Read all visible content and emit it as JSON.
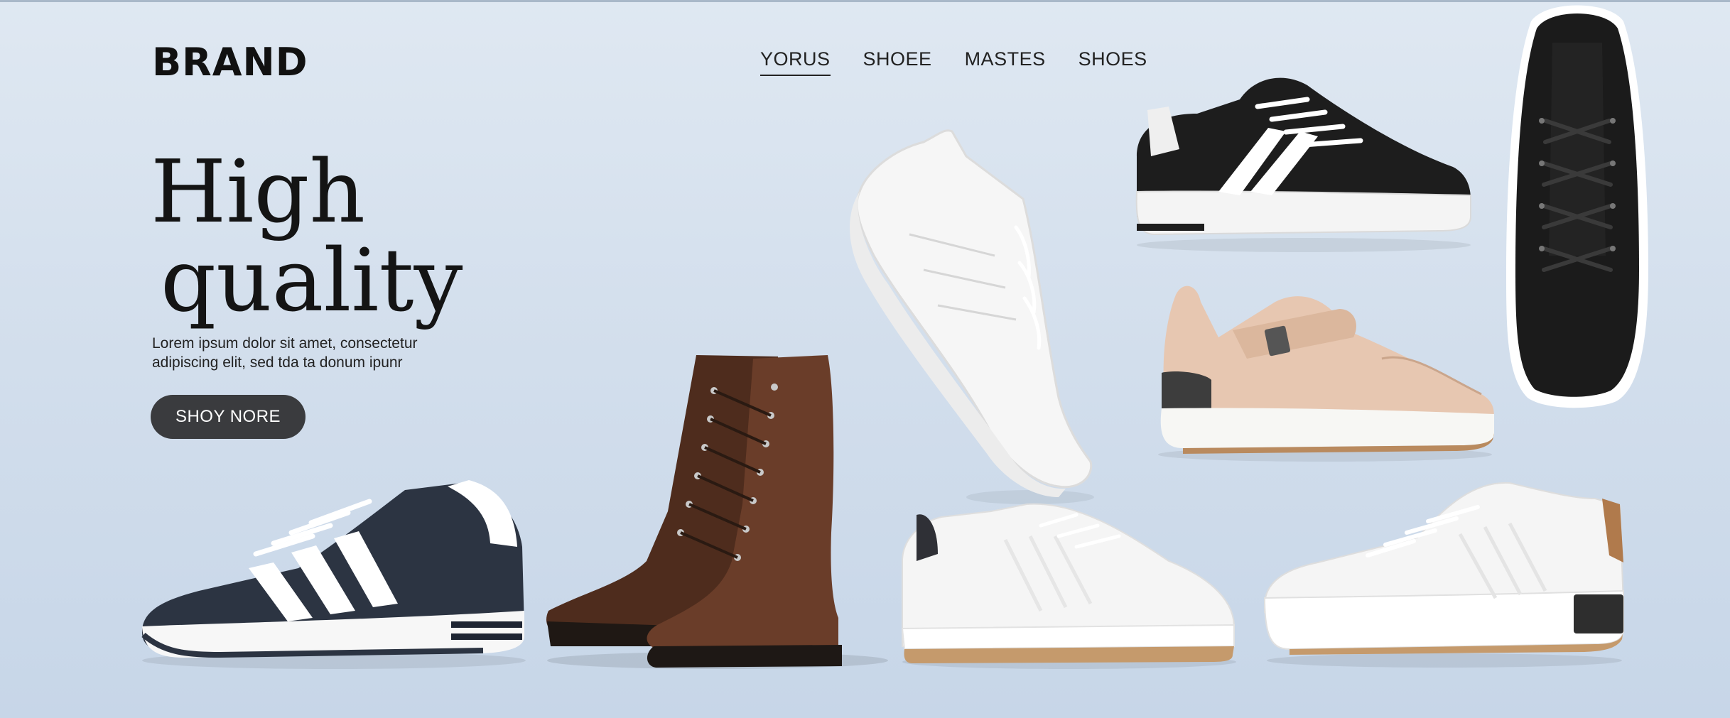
{
  "header": {
    "brand": "BRAND",
    "nav": [
      "YORUS",
      "SHOEE",
      "MASTES",
      "SHOES"
    ]
  },
  "hero": {
    "headline_line1": "High",
    "headline_line2": "quality",
    "body_line1": "Lorem ipsum dolor sit amet, consectetur",
    "body_line2": "adipiscing elit, sed tda ta donum ipunr",
    "cta_label": "SHOY NORE"
  },
  "products": [
    {
      "name": "navy-white-striped-sneaker",
      "color": "#2c3442",
      "accent": "#ffffff"
    },
    {
      "name": "brown-leather-boots",
      "color": "#5a3424",
      "accent": "#2a1c16"
    },
    {
      "name": "white-high-top-sneaker",
      "color": "#f6f6f6",
      "accent": "#e3e3e3"
    },
    {
      "name": "white-gum-sole-sneaker",
      "color": "#f4f4f4",
      "accent": "#c59a6c"
    },
    {
      "name": "black-white-striped-sneaker",
      "color": "#1d1d1d",
      "accent": "#ffffff"
    },
    {
      "name": "beige-strap-sandal",
      "color": "#e7c7b1",
      "accent": "#3d3d3d"
    },
    {
      "name": "black-leather-sneaker-top-view",
      "color": "#1b1b1b",
      "accent": "#ffffff"
    },
    {
      "name": "white-tan-heel-sneaker",
      "color": "#f5f5f5",
      "accent": "#b07a4c"
    }
  ]
}
